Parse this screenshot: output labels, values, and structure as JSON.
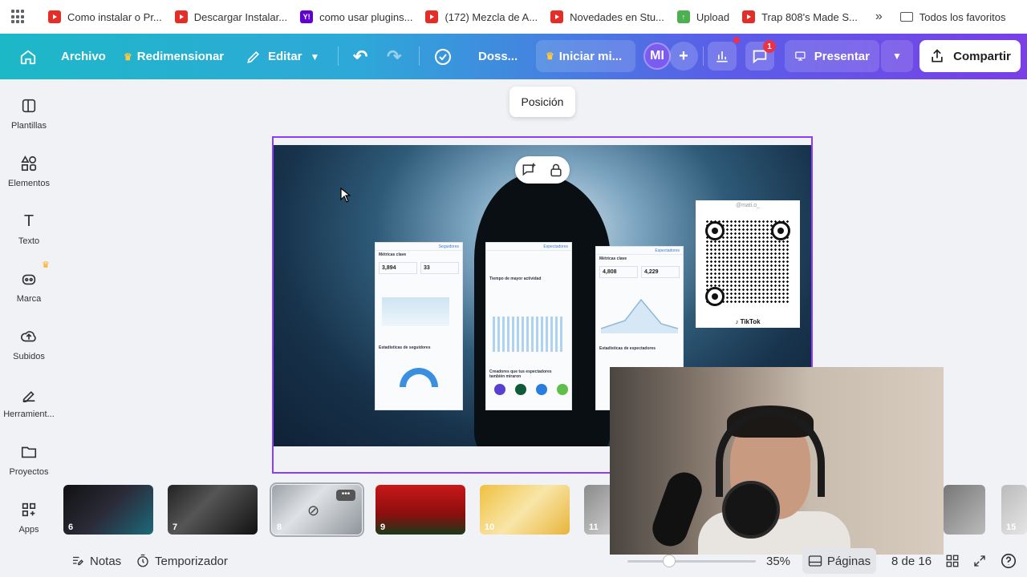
{
  "bookmarks": {
    "items": [
      {
        "label": "Como instalar o Pr...",
        "icon": "youtube-icon"
      },
      {
        "label": "Descargar Instalar...",
        "icon": "youtube-icon"
      },
      {
        "label": "como usar plugins...",
        "icon": "yahoo-icon"
      },
      {
        "label": "(172) Mezcla de A...",
        "icon": "youtube-icon"
      },
      {
        "label": "Novedades en Stu...",
        "icon": "youtube-icon"
      },
      {
        "label": "Upload",
        "icon": "upload-icon"
      },
      {
        "label": "Trap 808's Made S...",
        "icon": "youtube-icon"
      }
    ],
    "more": "»",
    "all_favorites": "Todos los favoritos"
  },
  "toolbar": {
    "archivo": "Archivo",
    "redimensionar": "Redimensionar",
    "editar": "Editar",
    "doc_title": "Doss...",
    "iniciar": "Iniciar mi...",
    "avatar": "MI",
    "comments_badge": "1",
    "presentar": "Presentar",
    "compartir": "Compartir"
  },
  "sidebar": {
    "items": [
      {
        "label": "Plantillas",
        "icon": "template-icon"
      },
      {
        "label": "Elementos",
        "icon": "elements-icon"
      },
      {
        "label": "Texto",
        "icon": "text-icon"
      },
      {
        "label": "Marca",
        "icon": "brand-icon"
      },
      {
        "label": "Subidos",
        "icon": "upload-cloud-icon"
      },
      {
        "label": "Herramient...",
        "icon": "tools-icon"
      },
      {
        "label": "Proyectos",
        "icon": "folder-icon"
      },
      {
        "label": "Apps",
        "icon": "apps-icon"
      }
    ]
  },
  "canvas": {
    "tooltip": "Posición",
    "qr_handle": "@mati.o_",
    "qr_label": "♪ TikTok",
    "card1": {
      "tab": "Seguidores",
      "title": "Métricas clave",
      "v1": "3,894",
      "v2": "33",
      "section": "Estadísticas de seguidores"
    },
    "card2": {
      "tab": "Espectadores",
      "title": "Tiempo de mayor actividad",
      "section": "Creadores que tus espectadores también miraron"
    },
    "card3": {
      "tab": "Espectadores",
      "title": "Métricas clave",
      "v1": "4,808",
      "v2": "4,229",
      "section": "Estadísticas de espectadores"
    }
  },
  "thumbnails": [
    "6",
    "7",
    "8",
    "9",
    "10",
    "11",
    "15"
  ],
  "bottom": {
    "notas": "Notas",
    "temporizador": "Temporizador",
    "zoom": "35%",
    "paginas": "Páginas",
    "page_count": "8 de 16"
  },
  "colors": {
    "accent": "#8b3dff",
    "toolbar_start": "#1db8c8",
    "toolbar_end": "#7a3fe6",
    "badge": "#e8334a"
  }
}
